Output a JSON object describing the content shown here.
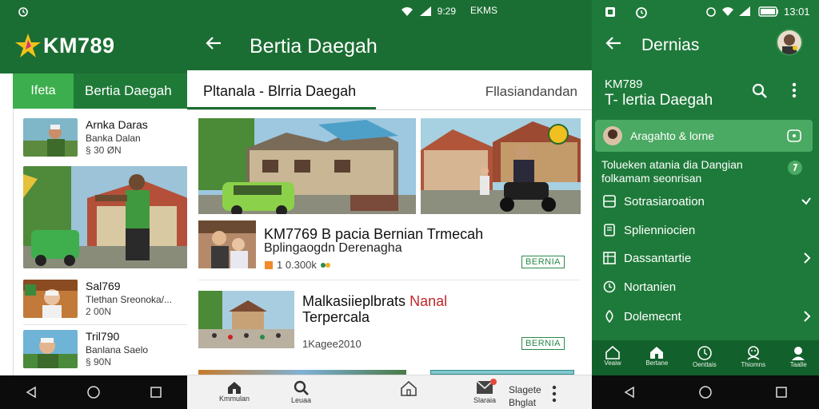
{
  "panel_left": {
    "status_icon": "sync-icon",
    "logo_text": "KM789",
    "tabs": [
      {
        "label": "Ifeta"
      },
      {
        "label": "Bertia Daegah"
      }
    ],
    "items": [
      {
        "title": "Arnka Daras",
        "subtitle": "Banka Dalan",
        "meta": "§ 30 ØN"
      },
      {
        "title": "Sal769",
        "subtitle": "Tlethan Sreonoka/...",
        "meta": "2 00N"
      },
      {
        "title": "Tril790",
        "subtitle": "Banlana Saelo",
        "meta": "§ 90N"
      }
    ]
  },
  "panel_middle": {
    "status_text": "9:29",
    "status_right": "EKMS",
    "title": "Bertia Daegah",
    "tab_primary": "Pltanala - Blrria Daegah",
    "tab_secondary": "Fllasiandandan",
    "articles": [
      {
        "title": "KM7769 B pacia Bernian Trmecah",
        "subtitle": "Bplingaogdn Derenagha",
        "meta": "1 0.300k",
        "badge": "BERNIA"
      },
      {
        "title_a": "Malkasiieplbrats",
        "title_b": "Nanal",
        "title_line2": "Terpercala",
        "meta": "1Kagee2010",
        "badge": "BERNIA"
      }
    ],
    "bottom_nav": [
      {
        "label": "Kmmulan",
        "icon": "home-icon"
      },
      {
        "label": "Leuaa",
        "icon": "search-icon"
      },
      {
        "label": "",
        "icon": "house-outline-icon"
      },
      {
        "label": "Slaraia",
        "icon": "mail-icon"
      },
      {
        "label": "Slagete\nBhglat",
        "icon": "more-icon"
      }
    ]
  },
  "panel_right": {
    "status_time": "13:01",
    "title": "Dernias",
    "brand_line1": "KM789",
    "brand_line2": "T- lertia Daegah",
    "active_item": "Aragahto & lorne",
    "note": "Tolueken atania dia Dangian folkamam seonrisan",
    "menu": [
      {
        "label": "Sotrasiaroation",
        "icon": "grid-icon",
        "chevron": "check"
      },
      {
        "label": "Splienniocien",
        "icon": "doc-icon",
        "chevron": ""
      },
      {
        "label": "Dassantartie",
        "icon": "table-icon",
        "chevron": "right"
      },
      {
        "label": "Nortanien",
        "icon": "clock-icon",
        "chevron": ""
      },
      {
        "label": "Dolemecnt",
        "icon": "pin-icon",
        "chevron": "right"
      }
    ],
    "bottom_nav": [
      {
        "label": "Veaiw",
        "icon": "home-outline-icon"
      },
      {
        "label": "Bertane",
        "icon": "home-icon"
      },
      {
        "label": "Oenttais",
        "icon": "clock-icon"
      },
      {
        "label": "Thiomns",
        "icon": "group-icon"
      },
      {
        "label": "Taalle",
        "icon": "profile-icon"
      }
    ]
  },
  "colors": {
    "brand_dark": "#1b6e33",
    "brand_mid": "#1f7a37",
    "brand_light": "#3cae4d",
    "drawer_bg": "#1e7a3a",
    "badge": "#2a8a4a"
  }
}
